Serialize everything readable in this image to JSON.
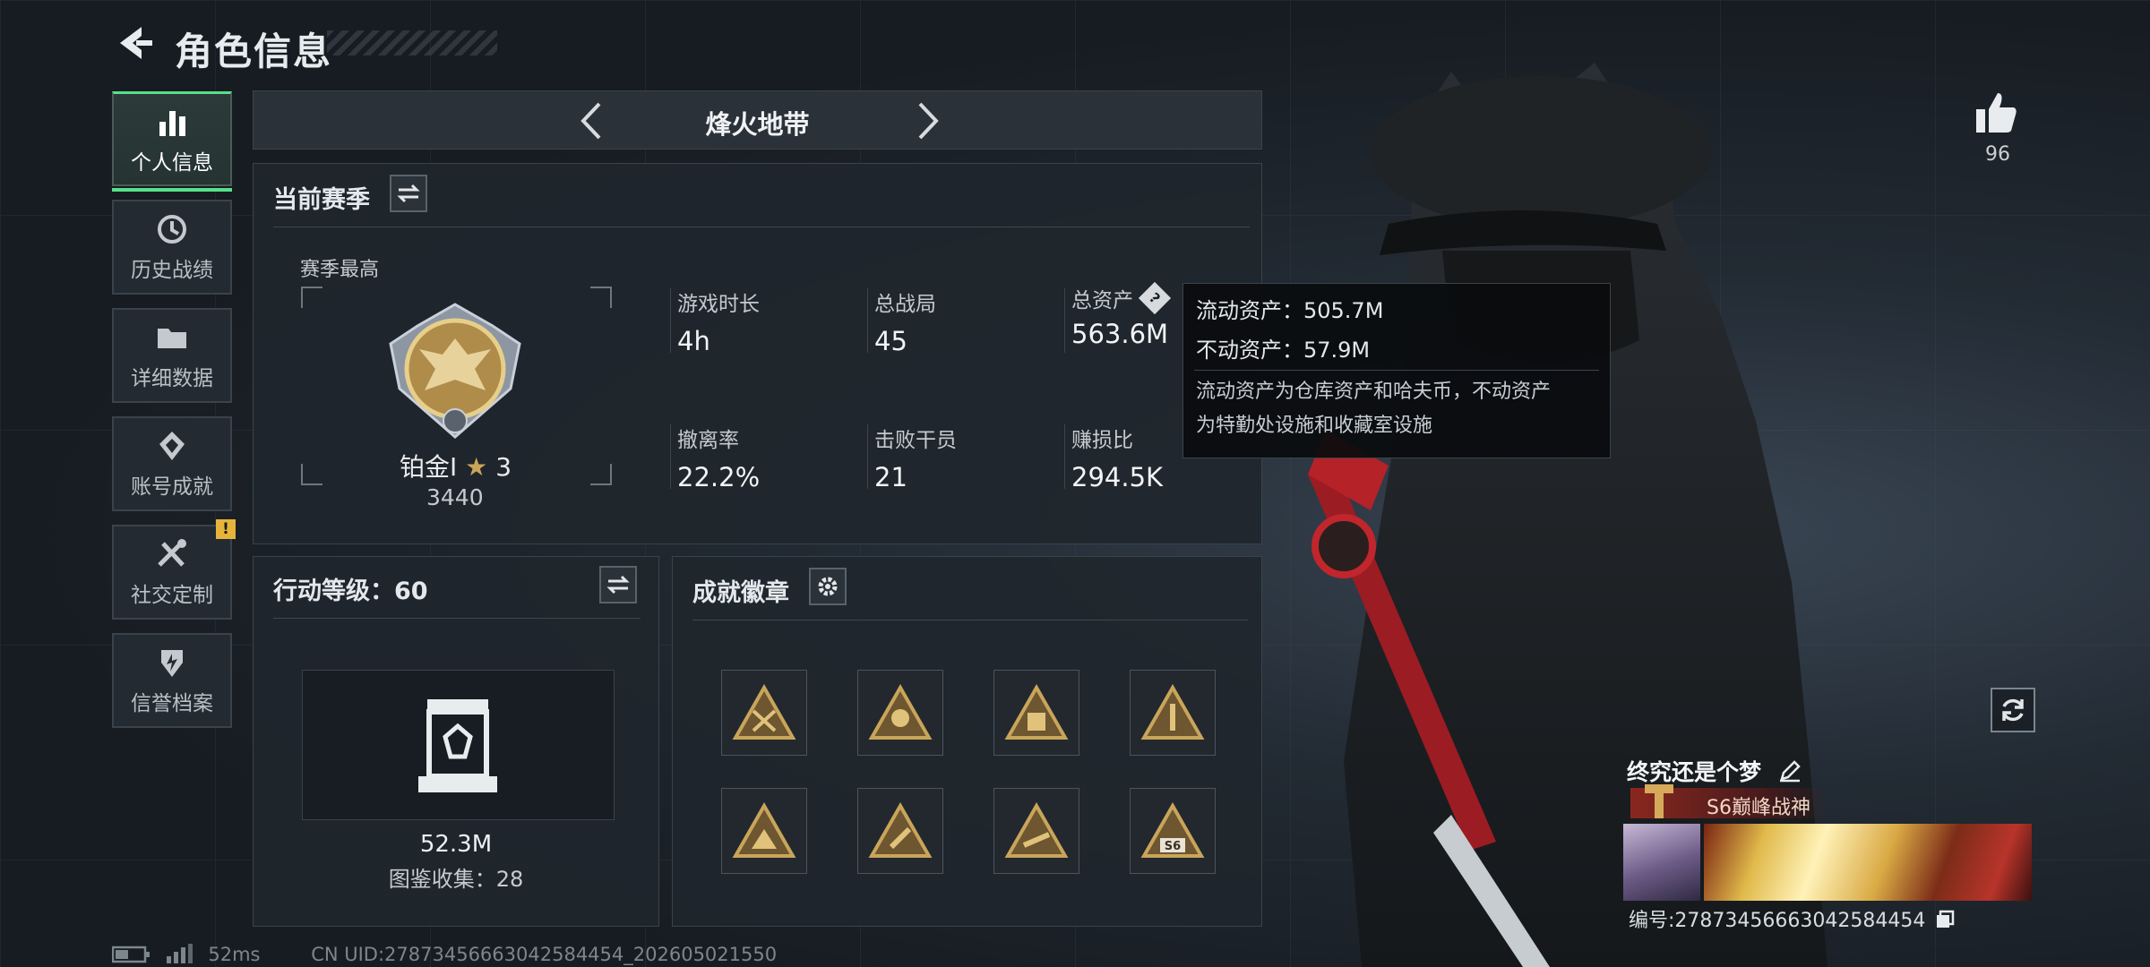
{
  "header": {
    "title": "角色信息"
  },
  "nav": [
    {
      "label": "个人信息",
      "icon": "bar-chart-icon",
      "active": true
    },
    {
      "label": "历史战绩",
      "icon": "history-icon"
    },
    {
      "label": "详细数据",
      "icon": "folder-icon"
    },
    {
      "label": "账号成就",
      "icon": "achievement-icon"
    },
    {
      "label": "社交定制",
      "icon": "tools-icon",
      "alert": "!"
    },
    {
      "label": "信誉档案",
      "icon": "shield-icon"
    }
  ],
  "mode": {
    "name": "烽火地带"
  },
  "season": {
    "title": "当前赛季",
    "best_label": "赛季最高",
    "rank_name": "铂金Ⅰ",
    "rank_stars": "3",
    "rank_score": "3440",
    "stats": [
      {
        "label": "游戏时长",
        "value": "4h"
      },
      {
        "label": "总战局",
        "value": "45"
      },
      {
        "label": "总资产",
        "value": "563.6M",
        "help": "?"
      },
      {
        "label": "撤离率",
        "value": "22.2%"
      },
      {
        "label": "击败干员",
        "value": "21"
      },
      {
        "label": "赚损比",
        "value": "294.5K"
      }
    ]
  },
  "tooltip": {
    "liquid": "流动资产：505.7M",
    "fixed": "不动资产：57.9M",
    "desc1": "流动资产为仓库资产和哈夫币，不动资产",
    "desc2": "为特勤处设施和收藏室设施"
  },
  "level": {
    "title": "行动等级：60",
    "value": "52.3M",
    "collection": "图鉴收集：28"
  },
  "badges": {
    "title": "成就徽章",
    "badge_label": "S6"
  },
  "player": {
    "likes": "96",
    "name": "终究还是个梦",
    "title": "S6巅峰战神",
    "id": "编号:2787345666304258445​4"
  },
  "footer": {
    "ping": "52ms",
    "uid": "CN UID:2787345666304258445​4_202605021550"
  },
  "colors": {
    "accent": "#57e08b",
    "gold": "#c9a55a",
    "alert": "#e6b43a"
  }
}
